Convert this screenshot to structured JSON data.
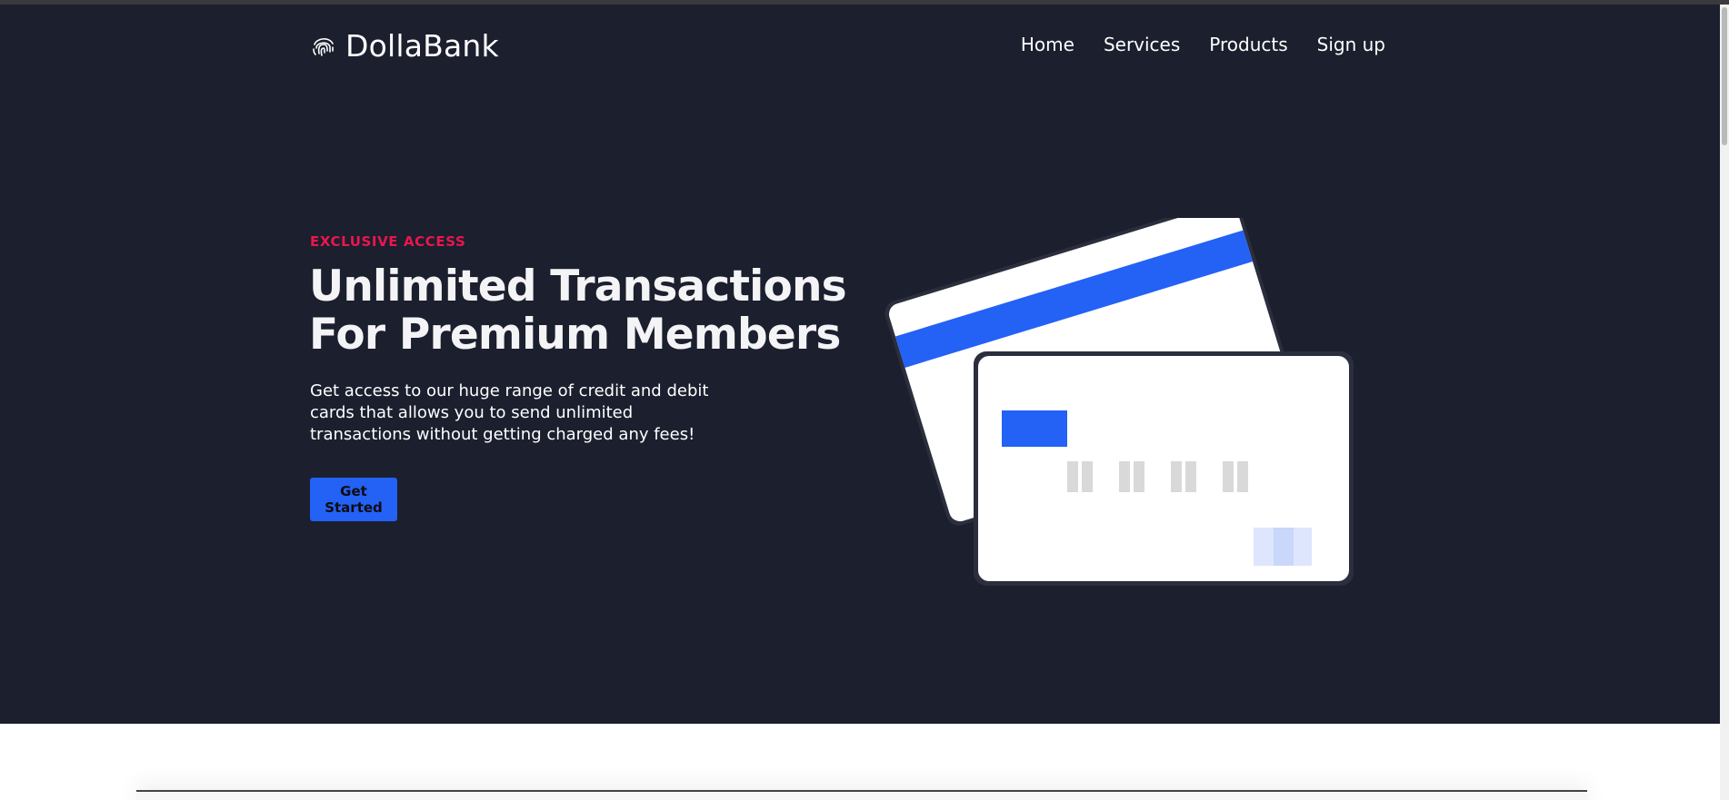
{
  "brand": {
    "name": "DollaBank",
    "icon": "fingerprint-icon"
  },
  "nav": {
    "items": [
      {
        "label": "Home"
      },
      {
        "label": "Services"
      },
      {
        "label": "Products"
      },
      {
        "label": "Sign up"
      }
    ]
  },
  "hero": {
    "eyebrow": "EXCLUSIVE ACCESS",
    "title_line_1": "Unlimited Transactions",
    "title_line_2": "For Premium Members",
    "description": "Get access to our huge range of credit and debit cards that allows you to send unlimited transactions without getting charged any fees!",
    "cta_label": "Get Started",
    "illustration": "credit-cards-illustration"
  },
  "colors": {
    "hero_background": "#1b1f2e",
    "accent_blue": "#2461f5",
    "eyebrow_red": "#e8174d",
    "text_white": "#ffffff"
  }
}
